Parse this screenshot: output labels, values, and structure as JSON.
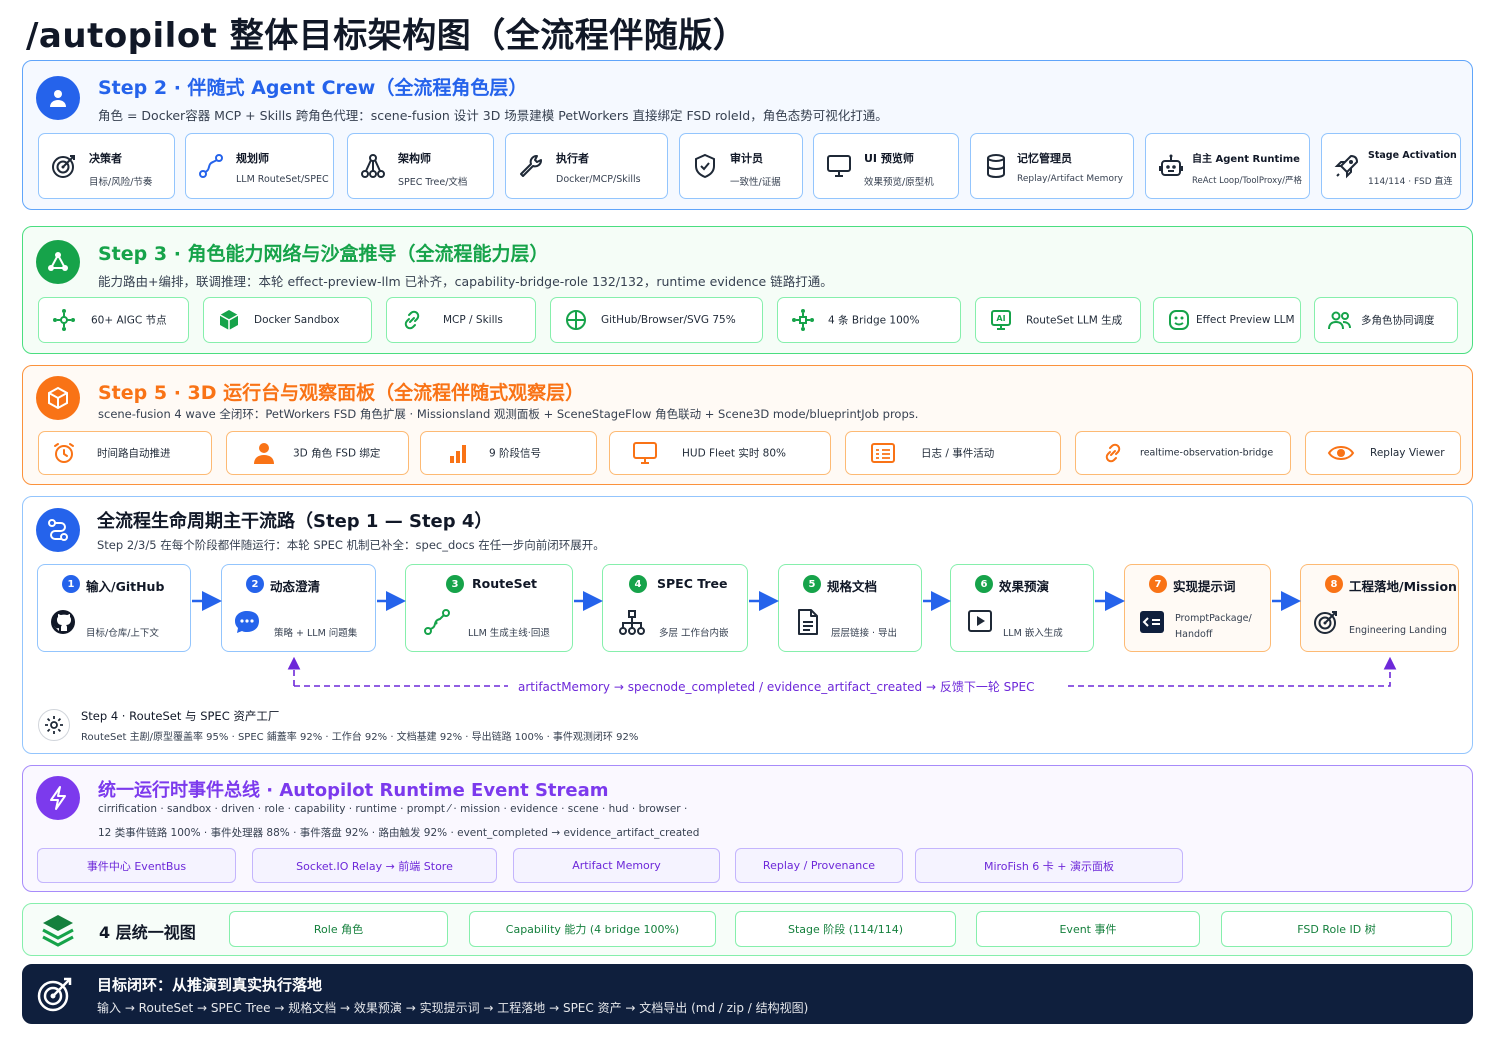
{
  "title": "/autopilot 整体目标架构图（全流程伴随版）",
  "step2": {
    "title": "Step 2 · 伴随式 Agent Crew（全流程角色层）",
    "subtitle": "角色 = Docker容器 MCP + Skills 跨角色代理：scene-fusion 设计 3D 场景建模 PetWorkers 直接绑定 FSD roleId，角色态势可视化打通。",
    "cards": [
      {
        "title": "决策者",
        "sub": "目标/风险/节奏",
        "icon": "target-icon"
      },
      {
        "title": "规划师",
        "sub": "LLM RouteSet/SPEC",
        "icon": "route-icon"
      },
      {
        "title": "架构师",
        "sub": "SPEC Tree/文档",
        "icon": "hierarchy-icon"
      },
      {
        "title": "执行者",
        "sub": "Docker/MCP/Skills",
        "icon": "wrench-icon"
      },
      {
        "title": "审计员",
        "sub": "一致性/证据",
        "icon": "shield-icon"
      },
      {
        "title": "UI 预览师",
        "sub": "效果预览/原型机",
        "icon": "monitor-icon"
      },
      {
        "title": "记忆管理员",
        "sub": "Replay/Artifact Memory",
        "icon": "database-icon"
      },
      {
        "title": "自主 Agent Runtime",
        "sub": "ReAct Loop/ToolProxy/严格",
        "icon": "robot-icon"
      },
      {
        "title": "Stage Activation",
        "sub": "114/114 · FSD 直连",
        "icon": "rocket-icon"
      }
    ]
  },
  "step3": {
    "title": "Step 3 · 角色能力网络与沙盒推导（全流程能力层）",
    "subtitle": "能力路由+编排，联调推理：本轮 effect-preview-llm 已补齐，capability-bridge-role 132/132，runtime evidence 链路打通。",
    "cards": [
      {
        "label": "60+ AIGC 节点",
        "icon": "nodes-icon"
      },
      {
        "label": "Docker Sandbox",
        "icon": "cube-icon"
      },
      {
        "label": "MCP / Skills",
        "icon": "link-icon"
      },
      {
        "label": "GitHub/Browser/SVG 75%",
        "icon": "globe-icon"
      },
      {
        "label": "4 条 Bridge 100%",
        "icon": "network-icon"
      },
      {
        "label": "RouteSet LLM 生成",
        "icon": "ai-screen-icon"
      },
      {
        "label": "Effect Preview LLM",
        "icon": "preview-icon"
      },
      {
        "label": "多角色协同调度",
        "icon": "users-icon"
      }
    ]
  },
  "step5": {
    "title": "Step 5 · 3D 运行台与观察面板（全流程伴随式观察层）",
    "subtitle": "scene-fusion 4 wave 全闭环：PetWorkers FSD 角色扩展 · Missionsland 观测面板 + SceneStageFlow 角色联动 + Scene3D mode/blueprintJob props.",
    "cards": [
      {
        "label": "时间路自动推进",
        "icon": "alarm-icon"
      },
      {
        "label": "3D 角色 FSD 绑定",
        "icon": "person-icon"
      },
      {
        "label": "9 阶段信号",
        "icon": "signal-bars-icon"
      },
      {
        "label": "HUD Fleet 实时 80%",
        "icon": "monitor-icon"
      },
      {
        "label": "日志 / 事件活动",
        "icon": "log-icon"
      },
      {
        "label": "realtime-observation-bridge",
        "icon": "link-icon"
      },
      {
        "label": "Replay Viewer",
        "icon": "eye-icon"
      }
    ]
  },
  "lifecycle": {
    "title": "全流程生命周期主干流路（Step 1 — Step 4）",
    "subtitle": "Step 2/3/5 在每个阶段都伴随运行：本轮 SPEC 机制已补全：spec_docs 在任一步向前闭环展开。",
    "flow": [
      {
        "num": "1",
        "title": "输入/GitHub",
        "sub": "目标/仓库/上下文",
        "icon": "github-icon"
      },
      {
        "num": "2",
        "title": "动态澄清",
        "sub": "策略 + LLM 问题集",
        "icon": "chat-icon"
      },
      {
        "num": "3",
        "title": "RouteSet",
        "sub": "LLM 生成主线·回退",
        "icon": "route-icon"
      },
      {
        "num": "4",
        "title": "SPEC Tree",
        "sub": "多层 工作台内嵌",
        "icon": "hierarchy-icon"
      },
      {
        "num": "5",
        "title": "规格文档",
        "sub": "层层链接 · 导出",
        "icon": "document-icon"
      },
      {
        "num": "6",
        "title": "效果预演",
        "sub": "LLM 嵌入生成",
        "icon": "play-icon"
      },
      {
        "num": "7",
        "title": "实现提示词",
        "sub": "PromptPackage/",
        "sub2": "Handoff",
        "icon": "code-icon"
      },
      {
        "num": "8",
        "title": "工程落地/Mission",
        "sub": "Engineering Landing",
        "icon": "target-icon"
      }
    ],
    "feedback": "artifactMemory → specnode_completed / evidence_artifact_created → 反馈下一轮 SPEC",
    "step4_title": "Step 4 · RouteSet 与 SPEC 资产工厂",
    "step4_metrics": "RouteSet 主剧/原型覆盖率 95% · SPEC 鋪蓋率 92% · 工作台 92% · 文档基建 92% · 导出链路 100% · 事件观测闭环 92%"
  },
  "eventbus": {
    "title": "统一运行时事件总线 · Autopilot Runtime Event Stream",
    "line1": "cirrification · sandbox · driven · role · capability · runtime · prompt ⁄ · mission · evidence · scene · hud · browser ·",
    "line2": "12 类事件链路 100% · 事件处理器 88% · 事件落盘 92% · 路由触发 92% · event_completed → evidence_artifact_created",
    "pills": [
      "事件中心 EventBus",
      "Socket.IO Relay → 前端 Store",
      "Artifact Memory",
      "Replay / Provenance",
      "MiroFish 6 卡 + 演示面板"
    ]
  },
  "layers": {
    "title": "4 层统一视图",
    "pills": [
      "Role 角色",
      "Capability 能力 (4 bridge 100%)",
      "Stage 阶段 (114/114)",
      "Event 事件",
      "FSD Role ID 树"
    ]
  },
  "goal": {
    "title": "目标闭环：从推演到真实执行落地",
    "sub": "输入 → RouteSet → SPEC Tree → 规格文档 → 效果预演 → 实现提示词 → 工程落地 → SPEC 资产 → 文档导出 (md / zip / 结构视图)"
  },
  "colors": {
    "blue": "#2563eb",
    "green": "#16a34a",
    "orange": "#f97316",
    "purple": "#7c3aed",
    "navy": "#0f1f3d"
  }
}
